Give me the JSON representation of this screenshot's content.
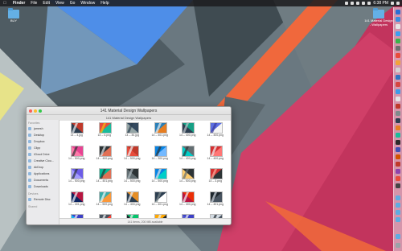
{
  "menubar": {
    "app_name": "Finder",
    "items": [
      "File",
      "Edit",
      "View",
      "Go",
      "Window",
      "Help"
    ],
    "clock": "6:38 PM"
  },
  "desktop": {
    "left_folder": "BUY",
    "right_folder": "141 Material Design - Wallpapers"
  },
  "finder": {
    "title": "141 Material Design Wallpapers",
    "tab": "141 Material Design Wallpapers",
    "status": "141 items, 200 MB available",
    "sidebar": {
      "favorites_header": "Favorites",
      "favorites": [
        "jamesh",
        "Desktop",
        "Dropbox",
        "Clipp",
        "iCloud Drive",
        "Creative Clou...",
        "AirDrop",
        "Applications",
        "Documents",
        "Downloads"
      ],
      "devices_header": "Devices",
      "devices": [
        "Remote Disc"
      ],
      "shared_header": "Shared"
    },
    "files": [
      "14 – 4.jpg",
      "14 – 4.png",
      "14 – 30.jpg",
      "14 – 401.png",
      "14 – 400.png",
      "14 – 400.png",
      "14 – 500.png",
      "14 – 400.png",
      "14 – 500.png",
      "14 – 300.png",
      "14 – 400.png",
      "14 – 400.png",
      "14 – 500.png",
      "14 – 401.png",
      "14 – 500.png",
      "14 – 500.png",
      "14 – 500.png",
      "14 – 3.png",
      "14 – 401.png",
      "14 – 500.png",
      "14 – 400.png",
      "14 – 401.png",
      "14 – 400.png",
      "14 – 401.png",
      "",
      "",
      "",
      "",
      "",
      ""
    ]
  },
  "colors": {
    "wallpaper_blue": "#5b8ee8",
    "wallpaper_magenta": "#c0365f",
    "wallpaper_orange": "#f4673e",
    "wallpaper_gray": "#5b6a73"
  }
}
